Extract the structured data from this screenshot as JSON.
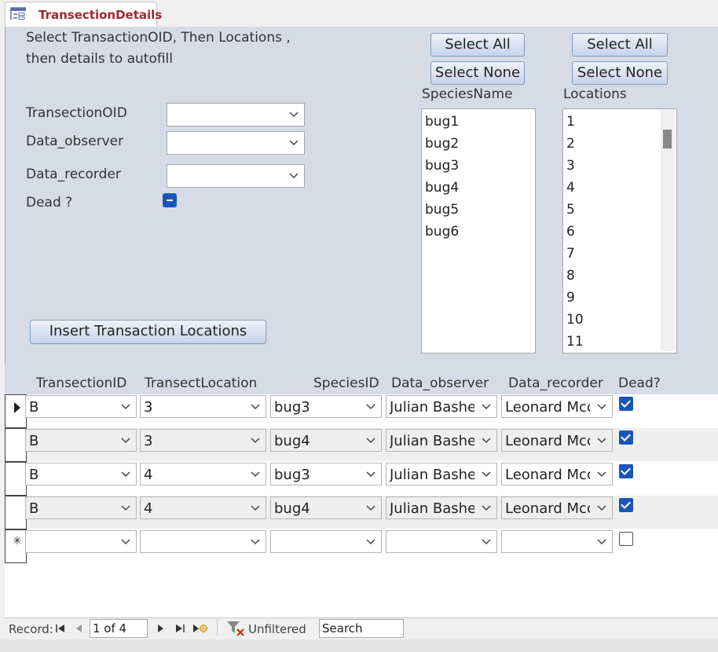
{
  "tab": {
    "title": "TransectionDetails",
    "icon": "form-icon"
  },
  "form": {
    "instruction_line1": "Select TransactionOID, Then Locations ,",
    "instruction_line2": "then details to autofill",
    "fields": {
      "transection_oid_label": "TransectionOID",
      "data_observer_label": "Data_observer",
      "data_recorder_label": "Data_recorder",
      "dead_label": "Dead ?",
      "transection_oid_value": "",
      "data_observer_value": "",
      "data_recorder_value": "",
      "dead_value": "indeterminate"
    },
    "species_select_all": "Select All",
    "species_select_none": "Select None",
    "locations_select_all": "Select All",
    "locations_select_none": "Select None",
    "species_list_label": "SpeciesName",
    "species_items": [
      "bug1",
      "bug2",
      "bug3",
      "bug4",
      "bug5",
      "bug6"
    ],
    "locations_list_label": "Locations",
    "locations_items": [
      "1",
      "2",
      "3",
      "4",
      "5",
      "6",
      "7",
      "8",
      "9",
      "10",
      "11"
    ],
    "insert_button": "Insert Transaction Locations"
  },
  "datasheet": {
    "headers": [
      "TransectionID",
      "TransectLocation",
      "SpeciesID",
      "Data_observer",
      "Data_recorder",
      "Dead?"
    ],
    "rows": [
      {
        "transection_id": "B",
        "transect_location": "3",
        "species_id": "bug3",
        "data_observer": "Julian Bashe",
        "data_recorder": "Leonard Mcc",
        "dead": true
      },
      {
        "transection_id": "B",
        "transect_location": "3",
        "species_id": "bug4",
        "data_observer": "Julian Bashe",
        "data_recorder": "Leonard Mcc",
        "dead": true
      },
      {
        "transection_id": "B",
        "transect_location": "4",
        "species_id": "bug3",
        "data_observer": "Julian Bashe",
        "data_recorder": "Leonard Mcc",
        "dead": true
      },
      {
        "transection_id": "B",
        "transect_location": "4",
        "species_id": "bug4",
        "data_observer": "Julian Bashe",
        "data_recorder": "Leonard Mcc",
        "dead": true
      }
    ],
    "new_row_marker": "✳"
  },
  "navigation": {
    "record_label": "Record:",
    "position": "1 of 4",
    "filter_status": "Unfiltered",
    "search_placeholder": "Search"
  },
  "colors": {
    "tab_title": "#a4262c",
    "form_bg": "#d6dbe6",
    "checkbox_on": "#1a56b8"
  }
}
